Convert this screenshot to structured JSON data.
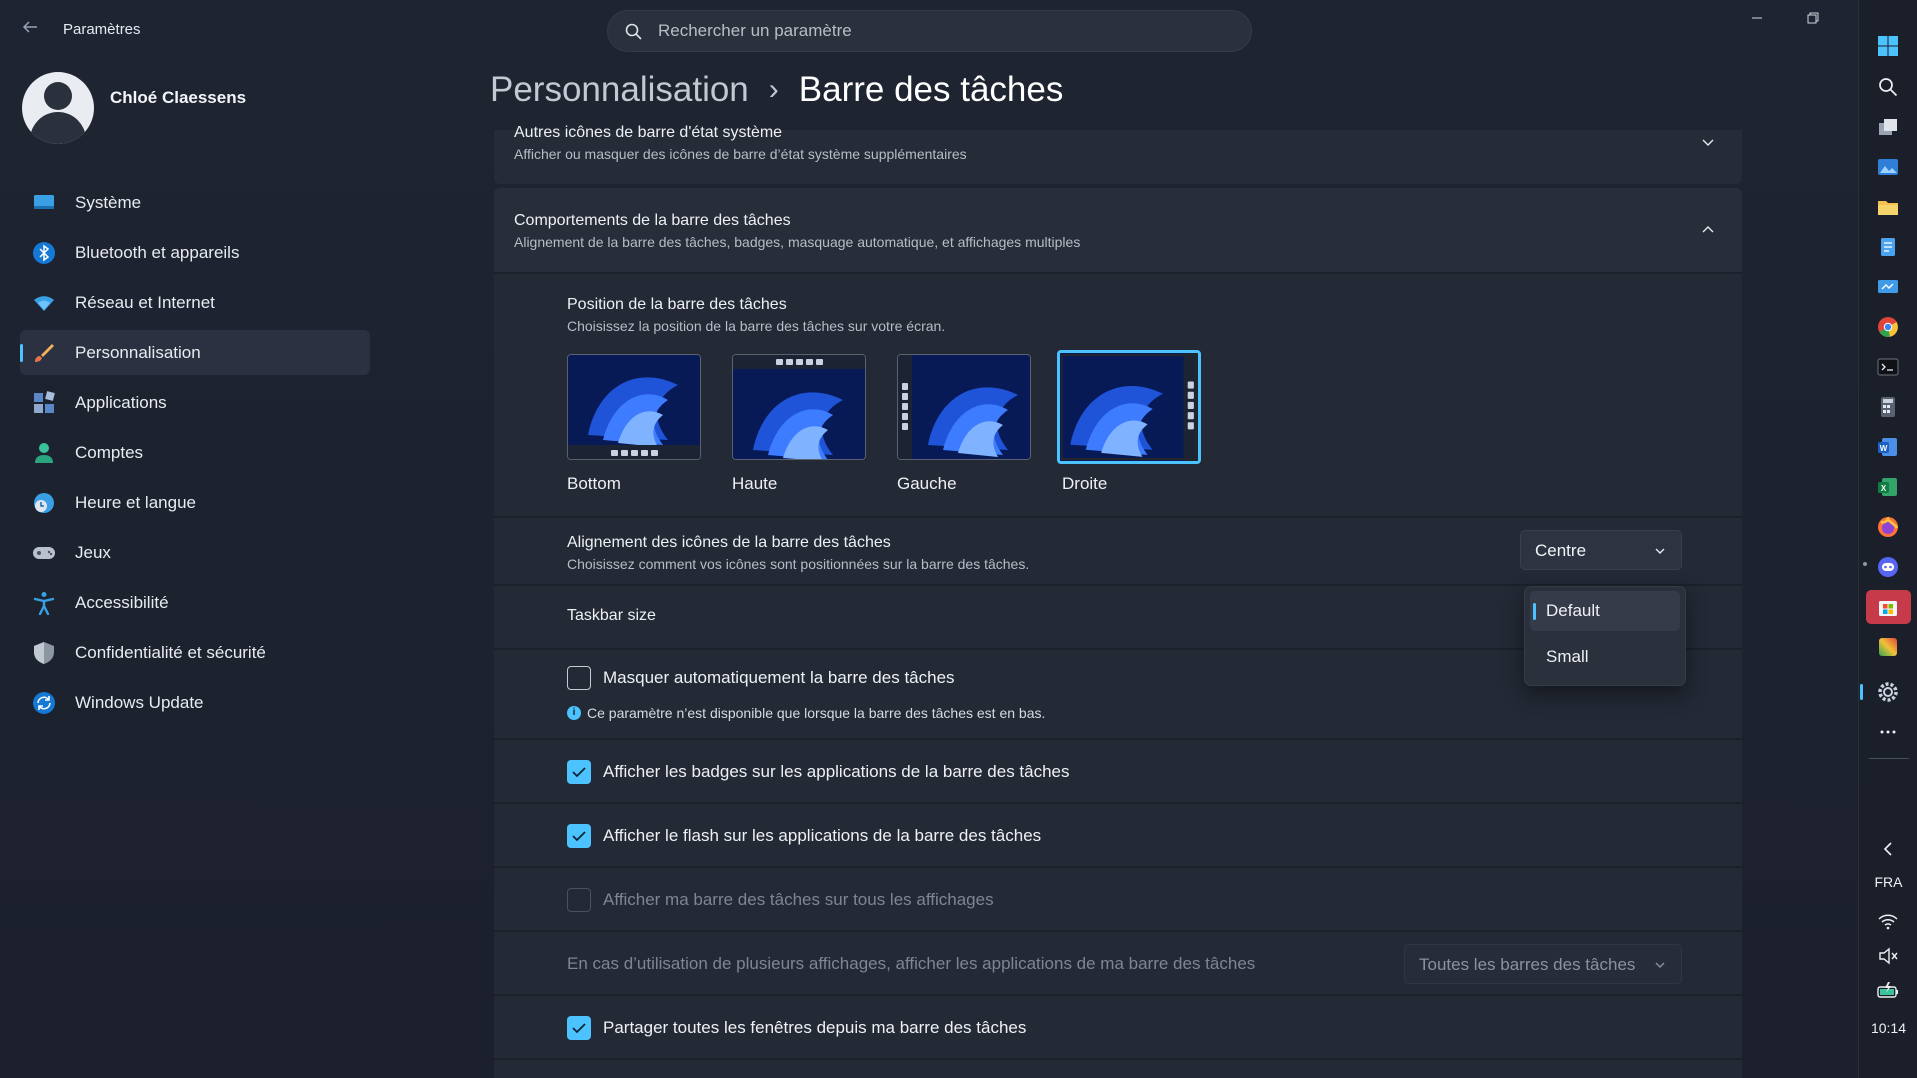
{
  "window": {
    "app_title": "Paramètres",
    "search_placeholder": "Rechercher un paramètre"
  },
  "profile": {
    "name": "Chloé Claessens"
  },
  "sidebar": {
    "items": [
      {
        "label": "Système",
        "icon": "system-icon",
        "active": false
      },
      {
        "label": "Bluetooth et appareils",
        "icon": "bluetooth-icon",
        "active": false
      },
      {
        "label": "Réseau et Internet",
        "icon": "wifi-icon",
        "active": false
      },
      {
        "label": "Personnalisation",
        "icon": "brush-icon",
        "active": true
      },
      {
        "label": "Applications",
        "icon": "apps-icon",
        "active": false
      },
      {
        "label": "Comptes",
        "icon": "person-icon",
        "active": false
      },
      {
        "label": "Heure et langue",
        "icon": "clock-icon",
        "active": false
      },
      {
        "label": "Jeux",
        "icon": "gamepad-icon",
        "active": false
      },
      {
        "label": "Accessibilité",
        "icon": "accessibility-icon",
        "active": false
      },
      {
        "label": "Confidentialité et sécurité",
        "icon": "shield-icon",
        "active": false
      },
      {
        "label": "Windows Update",
        "icon": "update-icon",
        "active": false
      }
    ]
  },
  "header": {
    "parent": "Personnalisation",
    "separator": "›",
    "current": "Barre des tâches"
  },
  "sections": {
    "tray_icons": {
      "title": "Autres icônes de barre d'état système",
      "desc": "Afficher ou masquer des icônes de barre d’état système supplémentaires"
    },
    "behaviors": {
      "title": "Comportements de la barre des tâches",
      "desc": "Alignement de la barre des tâches, badges, masquage automatique, et affichages multiples"
    },
    "position": {
      "title": "Position de la barre des tâches",
      "desc": "Choisissez la position de la barre des tâches sur votre écran.",
      "options": [
        "Bottom",
        "Haute",
        "Gauche",
        "Droite"
      ],
      "selected": "Droite"
    },
    "alignment": {
      "title": "Alignement des icônes de la barre des tâches",
      "desc": "Choisissez comment vos icônes sont positionnées sur la barre des tâches.",
      "value": "Centre"
    },
    "size": {
      "title": "Taskbar size",
      "options": [
        "Default",
        "Small"
      ],
      "selected": "Default"
    },
    "autohide": {
      "label": "Masquer automatiquement la barre des tâches",
      "checked": false,
      "note": "Ce paramètre n’est disponible que lorsque la barre des tâches est en bas."
    },
    "badges": {
      "label": "Afficher les badges sur les applications de la barre des tâches",
      "checked": true
    },
    "flash": {
      "label": "Afficher le flash sur les applications de la barre des tâches",
      "checked": true
    },
    "all_displays": {
      "label": "Afficher ma barre des tâches sur tous les affichages",
      "checked": false,
      "disabled": true
    },
    "multi_display": {
      "label": "En cas d’utilisation de plusieurs affichages, afficher les applications de ma barre des tâches",
      "value": "Toutes les barres des tâches",
      "disabled": true
    },
    "share_windows": {
      "label": "Partager toutes les fenêtres depuis ma barre des tâches",
      "checked": true
    }
  },
  "taskbar": {
    "language": "FRA",
    "time": "10:14"
  },
  "colors": {
    "accent": "#4cc2ff",
    "background": "#1d2330",
    "card": "#252b37"
  }
}
